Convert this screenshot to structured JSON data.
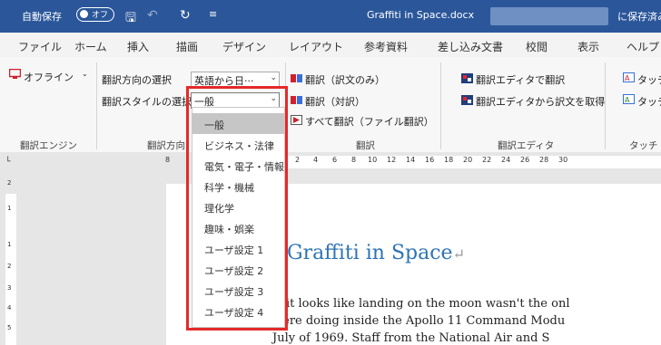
{
  "titlebar": {
    "autosave": "自動保存",
    "toggle": "オフ",
    "doc_name": "Graffiti in Space.docx",
    "saved": "に保存済み"
  },
  "tabs": [
    "ファイル",
    "ホーム",
    "挿入",
    "描画",
    "デザイン",
    "レイアウト",
    "参考資料",
    "差し込み文書",
    "校閲",
    "表示",
    "ヘルプ"
  ],
  "ribbon": {
    "offline": "オフライン",
    "direction_label": "翻訳方向の選択",
    "direction_value": "英語から日···",
    "style_label": "翻訳スタイルの選択",
    "style_value": "一般",
    "translate_only": "翻訳（訳文のみ）",
    "translate_pair": "翻訳（対訳）",
    "translate_all": "すべて翻訳（ファイル翻訳）",
    "editor_translate": "翻訳エディタで翻訳",
    "editor_get": "翻訳エディタから訳文を取得",
    "touch1": "タッチ",
    "touch2": "タッチ",
    "group_engine": "翻訳エンジン",
    "group_direction": "翻訳方向",
    "group_translate": "翻訳",
    "group_editor": "翻訳エディタ",
    "group_touch": "タッチ"
  },
  "ruler": {
    "h_numbers": [
      "8",
      "2",
      "4",
      "6",
      "8",
      "10",
      "12",
      "14",
      "16",
      "18",
      "20",
      "22",
      "24",
      "26",
      "28",
      "30"
    ],
    "v_numbers": [
      "2",
      "1",
      "1",
      "2",
      "3",
      "4",
      "5"
    ]
  },
  "dropdown": {
    "selected": "一般",
    "items": [
      "一般",
      "ビジネス・法律",
      "電気・電子・情報",
      "科学・機械",
      "理化学",
      "趣味・娯楽",
      "ユーザ設定 1",
      "ユーザ設定 2",
      "ユーザ設定 3",
      "ユーザ設定 4"
    ]
  },
  "document": {
    "title": "Graffiti in Space",
    "line1": "it looks like landing on the moon wasn't the onl",
    "line2": "were doing inside the Apollo 11 Command Modu",
    "line3": "July of 1969. Staff from the National Air and S"
  },
  "colors": {
    "titlebar": "#2b579a",
    "highlight_border": "#e5292a",
    "heading": "#2e74b5"
  }
}
